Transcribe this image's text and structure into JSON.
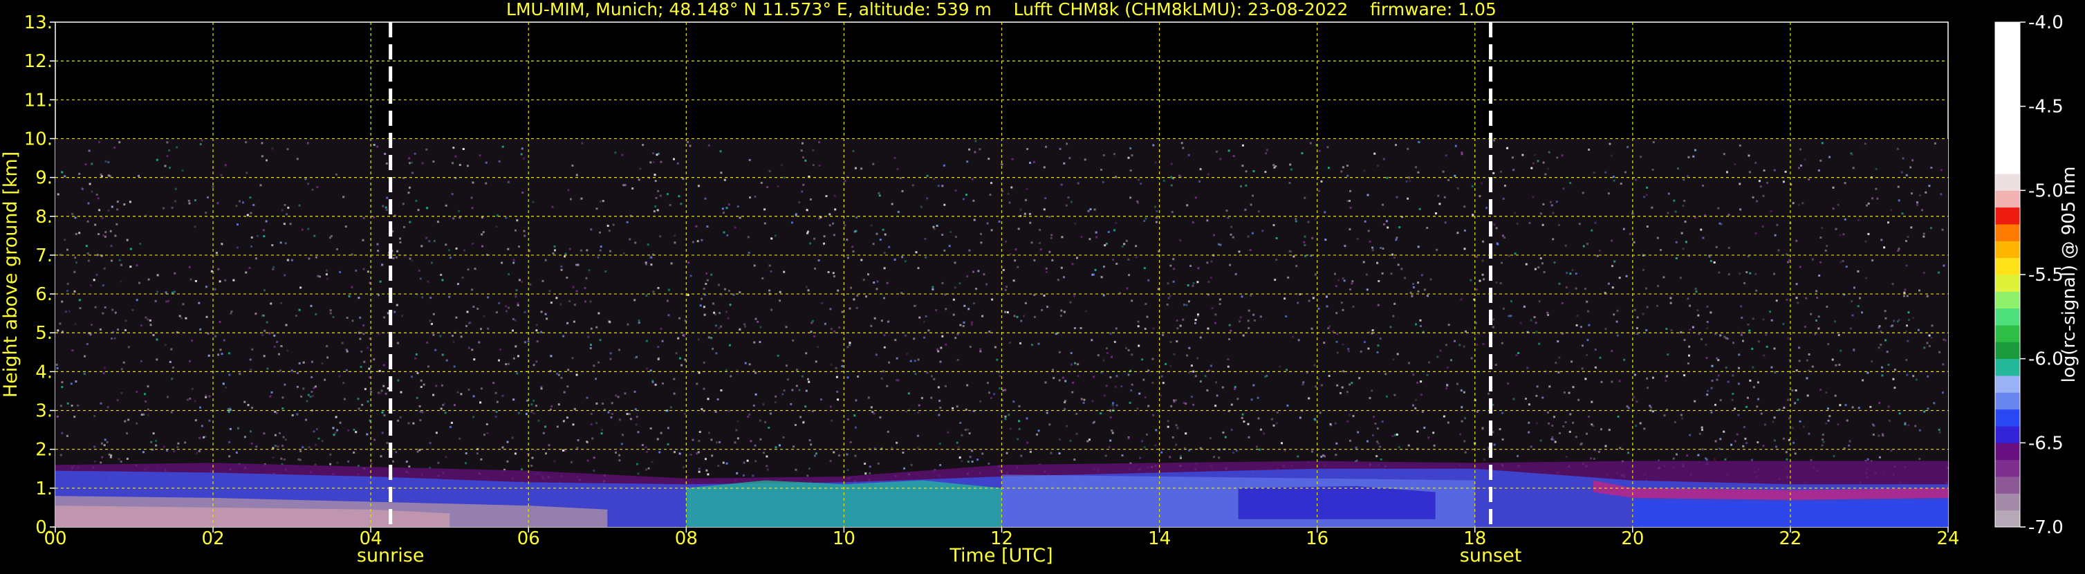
{
  "chart_data": {
    "type": "heatmap",
    "title": "LMU-MIM, Munich; 48.148° N 11.573° E, altitude: 539 m    Lufft CHM8k (CHM8kLMU): 23-08-2022    firmware: 1.05",
    "xlabel": "Time [UTC]",
    "ylabel": "Height above ground [km]",
    "xlim": [
      0,
      24
    ],
    "ylim": [
      0,
      13
    ],
    "x_ticks": [
      "00",
      "02",
      "04",
      "06",
      "08",
      "10",
      "12",
      "14",
      "16",
      "18",
      "20",
      "22",
      "24"
    ],
    "y_ticks": [
      "0.",
      "1.",
      "2.",
      "3.",
      "4.",
      "5.",
      "6.",
      "7.",
      "8.",
      "9.",
      "10.",
      "11.",
      "12.",
      "13."
    ],
    "grid": true,
    "data_max_height": 10.0,
    "sunrise": {
      "time": 4.25,
      "label": "sunrise"
    },
    "sunset": {
      "time": 18.2,
      "label": "sunset"
    },
    "colorbar": {
      "label": "log(rc-signal) @ 905 nm",
      "ticks": [
        "-4.0",
        "-4.5",
        "-5.0",
        "-5.5",
        "-6.0",
        "-6.5",
        "-7.0"
      ],
      "range": [
        -7.0,
        -4.0
      ],
      "colors": [
        {
          "from": -7.0,
          "to": -6.9,
          "color": "#b7a9b8"
        },
        {
          "from": -6.9,
          "to": -6.8,
          "color": "#a48aa9"
        },
        {
          "from": -6.8,
          "to": -6.7,
          "color": "#8d5a97"
        },
        {
          "from": -6.7,
          "to": -6.6,
          "color": "#7f2f8e"
        },
        {
          "from": -6.6,
          "to": -6.5,
          "color": "#6a0f7f"
        },
        {
          "from": -6.5,
          "to": -6.4,
          "color": "#3223d6"
        },
        {
          "from": -6.4,
          "to": -6.3,
          "color": "#2a48f4"
        },
        {
          "from": -6.3,
          "to": -6.2,
          "color": "#6a86f0"
        },
        {
          "from": -6.2,
          "to": -6.1,
          "color": "#9bb1f6"
        },
        {
          "from": -6.1,
          "to": -6.0,
          "color": "#23b89a"
        },
        {
          "from": -6.0,
          "to": -5.9,
          "color": "#1a9a3a"
        },
        {
          "from": -5.9,
          "to": -5.8,
          "color": "#2fbe45"
        },
        {
          "from": -5.8,
          "to": -5.7,
          "color": "#4ee07c"
        },
        {
          "from": -5.7,
          "to": -5.6,
          "color": "#8ff06c"
        },
        {
          "from": -5.6,
          "to": -5.5,
          "color": "#dff23a"
        },
        {
          "from": -5.5,
          "to": -5.4,
          "color": "#ffe21a"
        },
        {
          "from": -5.4,
          "to": -5.3,
          "color": "#ffb400"
        },
        {
          "from": -5.3,
          "to": -5.2,
          "color": "#ff7a00"
        },
        {
          "from": -5.2,
          "to": -5.1,
          "color": "#ee1c10"
        },
        {
          "from": -5.1,
          "to": -5.0,
          "color": "#f2b3b0"
        },
        {
          "from": -5.0,
          "to": -4.9,
          "color": "#ece0e0"
        },
        {
          "from": -4.9,
          "to": -4.0,
          "color": "#ffffff"
        }
      ]
    },
    "colors": {
      "text": "#ffff33",
      "colorbar_text": "#ffffff",
      "grid": "#e6e600",
      "background": "#000000"
    }
  }
}
